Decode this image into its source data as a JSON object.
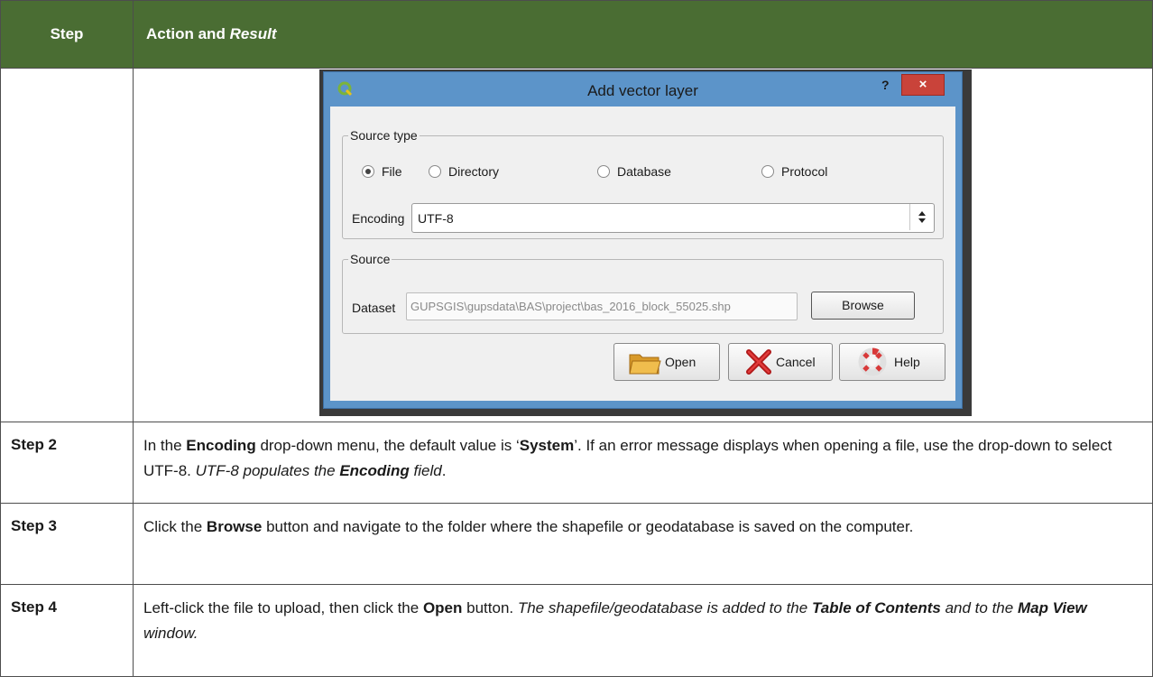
{
  "table": {
    "header_col1": "Step",
    "header_col2_plain": "Action and ",
    "header_col2_italic": "Result"
  },
  "dialog": {
    "title": "Add vector layer",
    "help_glyph": "?",
    "close_glyph": "×",
    "source_type_legend": "Source type",
    "radio_options": [
      "File",
      "Directory",
      "Database",
      "Protocol"
    ],
    "selected_option": "File",
    "encoding_label": "Encoding",
    "encoding_value": "UTF-8",
    "source_legend": "Source",
    "dataset_label": "Dataset",
    "dataset_value": "GUPSGIS\\gupsdata\\BAS\\project\\bas_2016_block_55025.shp",
    "browse_label": "Browse",
    "open_label": "Open",
    "cancel_label": "Cancel",
    "help_label": "Help"
  },
  "steps": [
    {
      "label": "Step 2",
      "t1": "In the ",
      "b1": "Encoding",
      "t2": " drop-down menu, the default value is ‘",
      "b2": "System",
      "t3": "’. If an error message displays when opening a file, use the drop-down to select UTF-8. ",
      "i1": "UTF-8 populates the ",
      "bi1": "Encoding",
      "i2": " field",
      "t4": "."
    },
    {
      "label": "Step 3",
      "t1": "Click the ",
      "b1": "Browse",
      "t2": " button and navigate to the folder where the shapefile or geodatabase is saved on the computer."
    },
    {
      "label": "Step 4",
      "t1": "Left-click the file to upload, then click the ",
      "b1": "Open",
      "t2": " button. ",
      "i1": "The shapefile/geodatabase is added to the ",
      "bi1": "Table of Contents",
      "i2": " and to the ",
      "bi2": "Map View",
      "i3": " window."
    }
  ]
}
